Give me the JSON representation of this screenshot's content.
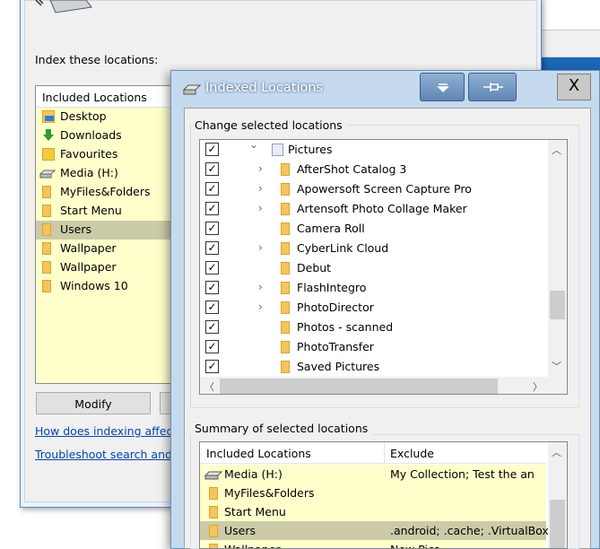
{
  "back_window": {
    "index_label": "Index these locations:",
    "list_header": "Included Locations",
    "items": [
      {
        "label": "Desktop",
        "icon": "desktop-folder-icon"
      },
      {
        "label": "Downloads",
        "icon": "downloads-icon"
      },
      {
        "label": "Favourites",
        "icon": "favourites-icon"
      },
      {
        "label": "Media (H:)",
        "icon": "drive-icon"
      },
      {
        "label": "MyFiles&Folders",
        "icon": "folder-icon"
      },
      {
        "label": "Start Menu",
        "icon": "folder-icon"
      },
      {
        "label": "Users",
        "icon": "folder-icon",
        "selected": true
      },
      {
        "label": "Wallpaper",
        "icon": "folder-icon"
      },
      {
        "label": "Wallpaper",
        "icon": "folder-icon"
      },
      {
        "label": "Windows 10",
        "icon": "folder-icon"
      }
    ],
    "modify_button": "Modify",
    "link1": "How does indexing affect s",
    "link2": "Troubleshoot search and in"
  },
  "dialog": {
    "title": "Indexed Locations",
    "close_glyph": "X",
    "change_group": "Change selected locations",
    "tree": [
      {
        "label": "Pictures",
        "level": 0,
        "expander": "down",
        "checked": true
      },
      {
        "label": "AfterShot Catalog 3",
        "level": 1,
        "expander": "right",
        "checked": true
      },
      {
        "label": "Apowersoft Screen Capture Pro",
        "level": 1,
        "expander": "right",
        "checked": true
      },
      {
        "label": "Artensoft Photo Collage Maker",
        "level": 1,
        "expander": "right",
        "checked": true
      },
      {
        "label": "Camera Roll",
        "level": 1,
        "expander": "",
        "checked": true
      },
      {
        "label": "CyberLink Cloud",
        "level": 1,
        "expander": "right",
        "checked": true
      },
      {
        "label": "Debut",
        "level": 1,
        "expander": "",
        "checked": true
      },
      {
        "label": "FlashIntegro",
        "level": 1,
        "expander": "right",
        "checked": true
      },
      {
        "label": "PhotoDirector",
        "level": 1,
        "expander": "right",
        "checked": true
      },
      {
        "label": "Photos - scanned",
        "level": 1,
        "expander": "",
        "checked": true
      },
      {
        "label": "PhotoTransfer",
        "level": 1,
        "expander": "",
        "checked": true
      },
      {
        "label": "Saved Pictures",
        "level": 1,
        "expander": "",
        "checked": true
      }
    ],
    "summary_group": "Summary of selected locations",
    "summary_headers": {
      "included": "Included Locations",
      "exclude": "Exclude"
    },
    "summary_rows": [
      {
        "location": "Media (H:)",
        "exclude": "My Collection; Test the an",
        "icon": "drive-icon"
      },
      {
        "location": "MyFiles&Folders",
        "exclude": "",
        "icon": "folder-icon"
      },
      {
        "location": "Start Menu",
        "exclude": "",
        "icon": "folder-icon"
      },
      {
        "location": "Users",
        "exclude": ".android; .cache; .VirtualBox; .",
        "icon": "folder-icon",
        "selected": true
      },
      {
        "location": "Wallpaper",
        "exclude": "New Pics",
        "icon": "folder-icon"
      }
    ],
    "check_glyph": "✓",
    "colors": {
      "accent": "#1c68b6",
      "list_bg": "#ffffcc",
      "selected": "#cbcba8"
    }
  }
}
